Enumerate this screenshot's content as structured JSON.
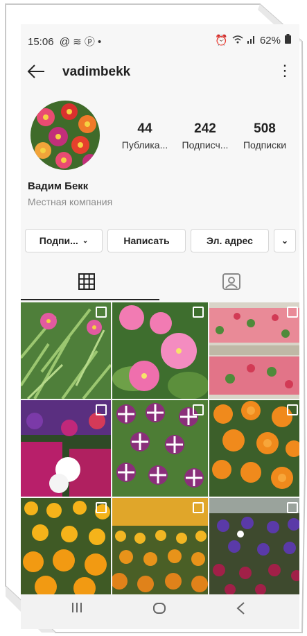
{
  "status_bar": {
    "time": "15:06",
    "notif_icons": "@ ≋ ⓟ •",
    "battery": "62%"
  },
  "header": {
    "username": "vadimbekk"
  },
  "stats": [
    {
      "value": "44",
      "label": "Публика..."
    },
    {
      "value": "242",
      "label": "Подписч..."
    },
    {
      "value": "508",
      "label": "Подписки"
    }
  ],
  "profile": {
    "name": "Вадим Бекк",
    "category": "Местная компания"
  },
  "buttons": {
    "follow": "Подпи...",
    "message": "Написать",
    "email": "Эл. адрес"
  },
  "colors": {
    "accent": "#222222",
    "secondary_text": "#8a8a8a"
  },
  "grid_posts": [
    {
      "name": "pink-portulaca-post",
      "multi": true
    },
    {
      "name": "pink-petunia-post",
      "multi": true
    },
    {
      "name": "begonia-beds-post",
      "multi": true
    },
    {
      "name": "mixed-petunias-post",
      "multi": true
    },
    {
      "name": "striped-petunias-post",
      "multi": true
    },
    {
      "name": "orange-marigold-post",
      "multi": true
    },
    {
      "name": "yellow-marigold-post",
      "multi": true
    },
    {
      "name": "marigold-field-post",
      "multi": true
    },
    {
      "name": "pansy-bed-post",
      "multi": true
    }
  ]
}
